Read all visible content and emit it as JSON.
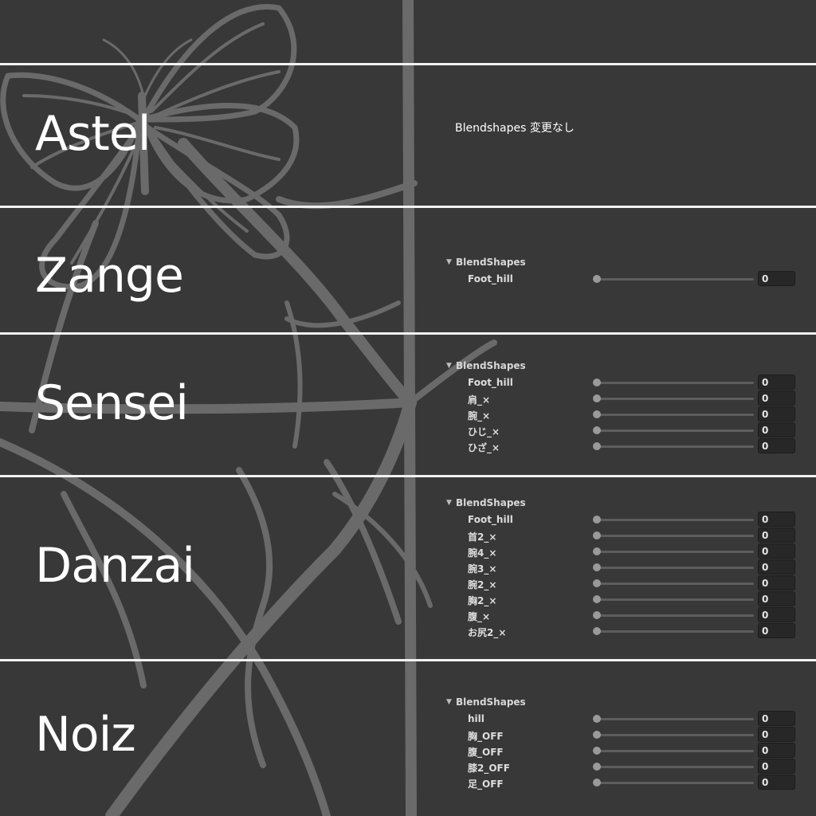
{
  "sections": [
    {
      "name": "Astel",
      "note": "Blendshapes 変更なし"
    },
    {
      "name": "Zange",
      "header": "BlendShapes",
      "items": [
        {
          "label": "Foot_hill",
          "value": "0"
        }
      ]
    },
    {
      "name": "Sensei",
      "header": "BlendShapes",
      "items": [
        {
          "label": "Foot_hill",
          "value": "0"
        },
        {
          "label": "肩_×",
          "value": "0"
        },
        {
          "label": "腕_×",
          "value": "0"
        },
        {
          "label": "ひじ_×",
          "value": "0"
        },
        {
          "label": "ひざ_×",
          "value": "0"
        }
      ]
    },
    {
      "name": "Danzai",
      "header": "BlendShapes",
      "items": [
        {
          "label": "Foot_hill",
          "value": "0"
        },
        {
          "label": "首2_×",
          "value": "0"
        },
        {
          "label": "腕4_×",
          "value": "0"
        },
        {
          "label": "腕3_×",
          "value": "0"
        },
        {
          "label": "腕2_×",
          "value": "0"
        },
        {
          "label": "胸2_×",
          "value": "0"
        },
        {
          "label": "腹_×",
          "value": "0"
        },
        {
          "label": "お尻2_×",
          "value": "0"
        }
      ]
    },
    {
      "name": "Noiz",
      "header": "BlendShapes",
      "items": [
        {
          "label": "hill",
          "value": "0"
        },
        {
          "label": "胸_OFF",
          "value": "0"
        },
        {
          "label": "腹_OFF",
          "value": "0"
        },
        {
          "label": "膝2_OFF",
          "value": "0"
        },
        {
          "label": "足_OFF",
          "value": "0"
        }
      ]
    }
  ],
  "colors": {
    "background": "#383838",
    "divider": "#f2f2f2",
    "art_line": "#6a6a6a"
  },
  "icons": {
    "foldout": "triangle-down-icon",
    "slider": "slider-knob"
  }
}
